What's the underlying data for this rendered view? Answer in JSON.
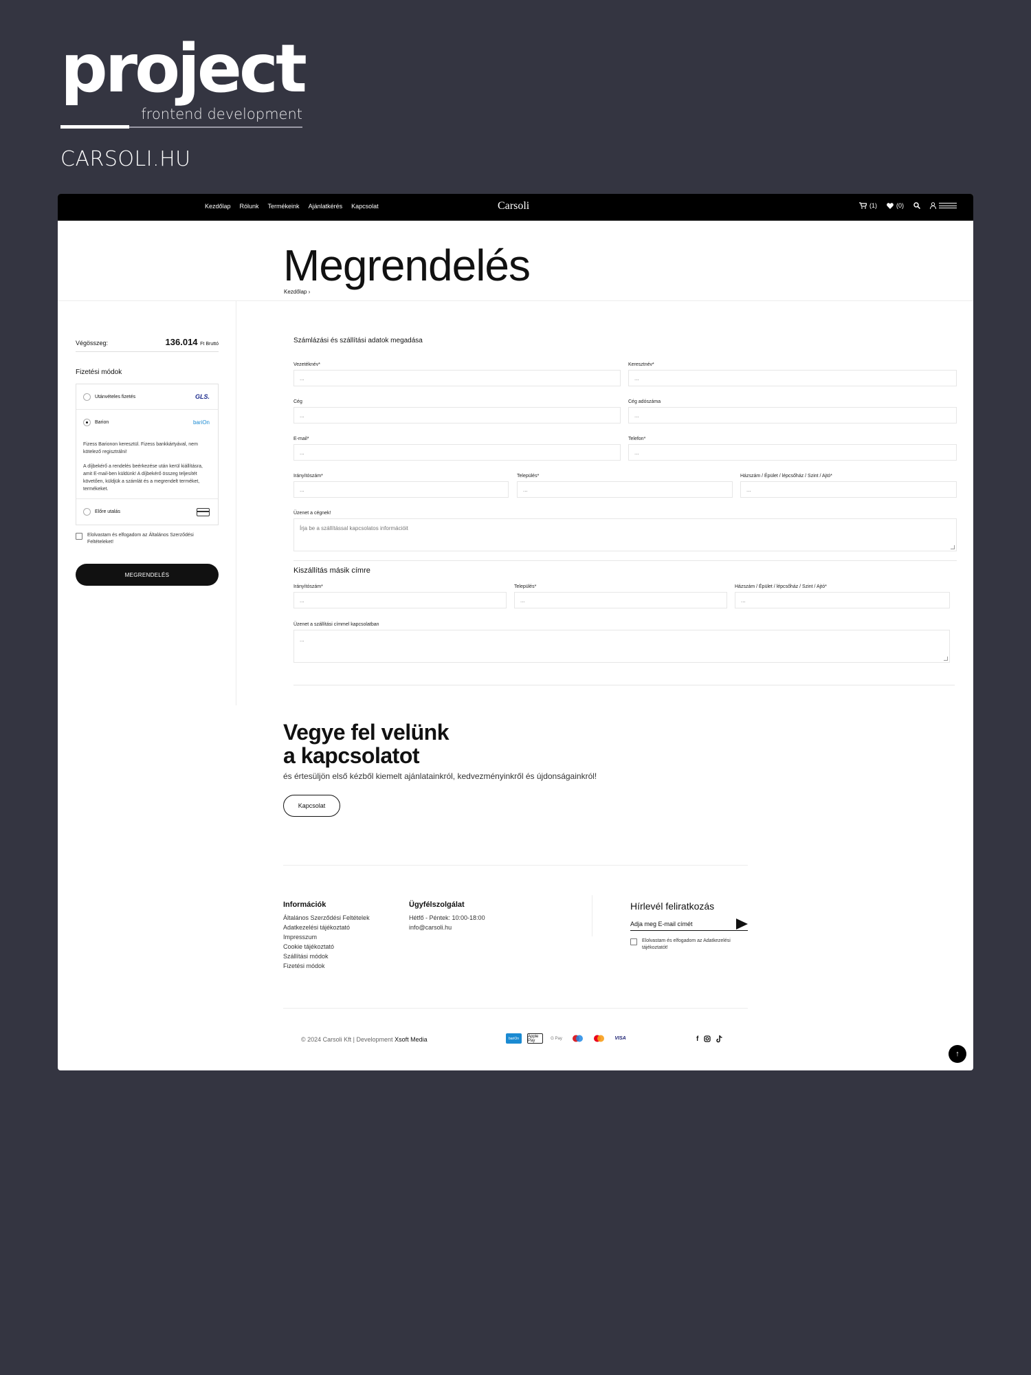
{
  "brand": {
    "word": "project",
    "sub": "frontend development",
    "site": "CARSOLI.HU"
  },
  "nav": {
    "links": [
      "Kezdőlap",
      "Rólunk",
      "Termékeink",
      "Ajánlatkérés",
      "Kapcsolat"
    ],
    "logo": "Carsoli",
    "cart_count": "(1)",
    "wish_count": "(0)"
  },
  "hero": {
    "title": "Megrendelés",
    "breadcrumb": "Kezdőlap ›"
  },
  "summary": {
    "total_label": "Végösszeg:",
    "total_value": "136.014",
    "total_unit": "Ft Bruttó",
    "payment_title": "Fizetési módok",
    "options": [
      {
        "label": "Utánvételes fizetés",
        "logo": "GLS."
      },
      {
        "label": "Barion",
        "logo": "bariOn"
      },
      {
        "label": "Előre utalás"
      }
    ],
    "desc1": "Fizess Barionon keresztül. Fizess bankkártyával, nem kötelező regisztrálni!",
    "desc2": "A díjbekérő a rendelés beérkezése után kerül kiállításra, amit E-mail-ben küldünk! A díjbekérő összeg teljesítét követően, küldjük a számlát és a megrendelt terméket, termékeket.",
    "terms": "Elolvastam és elfogadom az Általános Szerződési Feltételeket!",
    "order_button": "MEGRENDELÉS"
  },
  "form": {
    "title": "Számlázási és szállítási adatok megadása",
    "placeholder": "...",
    "lastname": "Vezetéknév*",
    "firstname": "Keresztnév*",
    "company": "Cég",
    "tax": "Cég adószáma",
    "email": "E-mail*",
    "phone": "Telefon*",
    "zip": "Irányítószám*",
    "city": "Település*",
    "address": "Házszám / Épület / lépcsőház / Szint / Ajtó*",
    "message_label": "Üzenet a cégnek!",
    "message_placeholder": "Írja be a szállítással kapcsolatos információit",
    "ship_title": "Kiszállítás másik címre",
    "ship_message_label": "Üzenet a szállítási címmel kapcsolatban"
  },
  "contact": {
    "line1": "Vegye fel velünk",
    "line2": "a kapcsolatot",
    "sub": "és értesüljön első kézből kiemelt ajánlatainkról, kedvezményinkről és újdonságainkról!",
    "button": "Kapcsolat"
  },
  "footer": {
    "info_title": "Információk",
    "info_links": [
      "Általános Szerződési Feltételek",
      "Adatkezelési tájékoztató",
      "Impresszum",
      "Cookie tájékoztató",
      "Szállítási módok",
      "Fizetési módok"
    ],
    "service_title": "Ügyfélszolgálat",
    "hours": "Hétfő - Péntek: 10:00-18:00",
    "email": "info@carsoli.hu",
    "news_title": "Hírlevél feliratkozás",
    "news_placeholder": "Adja meg E-mail címét",
    "news_terms": "Elolvastam és elfogadom az Adatkezelési tájékoztatót!",
    "copyright": "© 2024 Carsoli Kft | Development",
    "dev": "Xsoft Media",
    "payment_icons": [
      "bariOn",
      "Apple Pay",
      "G Pay",
      "maestro",
      "mastercard",
      "VISA"
    ]
  },
  "colors": {
    "bg": "#343541",
    "nav": "#000000",
    "accent": "#111111"
  }
}
